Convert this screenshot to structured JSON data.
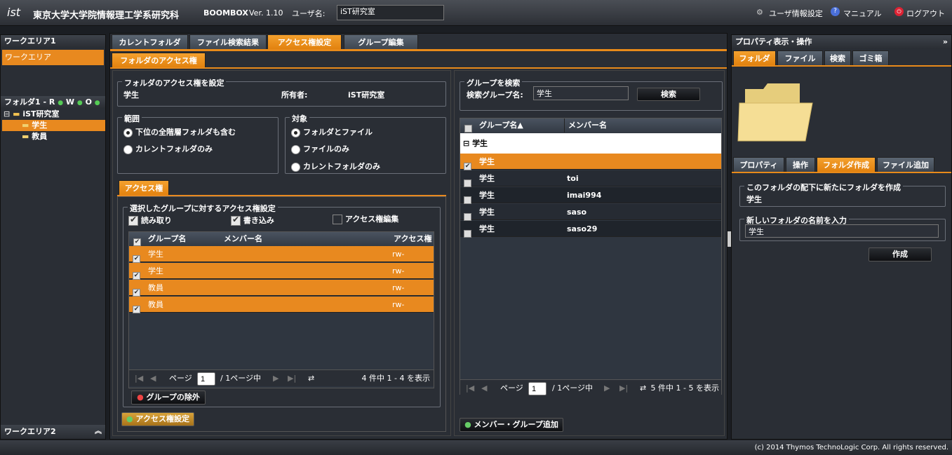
{
  "header": {
    "logo": "ist",
    "org": "東京大学大学院情報理工学系研究科",
    "product": "BOOMBOX",
    "version": "Ver. 1.10",
    "user_label": "ユーザ名:",
    "user_value": "iST研究室",
    "user_settings": "ユーザ情報設定",
    "manual": "マニュアル",
    "logout": "ログアウト"
  },
  "left": {
    "wa1_title": "ワークエリア1",
    "wa1_item": "ワークエリア",
    "folder1_title": "フォルダ1 - R",
    "perm_w": "W",
    "perm_o": "O",
    "tree_root": "iST研究室",
    "tree_items": [
      "学生",
      "教員"
    ],
    "wa2_title": "ワークエリア2"
  },
  "tabs": [
    "カレントフォルダ",
    "ファイル検索結果",
    "アクセス権設定",
    "グループ編集"
  ],
  "subtab": "フォルダのアクセス権",
  "access": {
    "legend": "フォルダのアクセス権を設定",
    "folder_name": "学生",
    "owner_label": "所有者:",
    "owner_value": "iST研究室",
    "scope_legend": "範囲",
    "scope_opts": [
      "下位の全階層フォルダも含む",
      "カレントフォルダのみ"
    ],
    "target_legend": "対象",
    "target_opts": [
      "フォルダとファイル",
      "ファイルのみ",
      "カレントフォルダのみ"
    ],
    "perm_tab": "アクセス権",
    "perm_legend": "選択したグループに対するアクセス権設定",
    "read": "読み取り",
    "write": "書き込み",
    "edit": "アクセス権編集",
    "cols": [
      "グループ名",
      "メンバー名",
      "アクセス権"
    ],
    "rows": [
      {
        "g": "学生",
        "m": "",
        "a": "rw-"
      },
      {
        "g": "学生",
        "m": "",
        "a": "rw-"
      },
      {
        "g": "教員",
        "m": "",
        "a": "rw-"
      },
      {
        "g": "教員",
        "m": "",
        "a": "rw-"
      }
    ],
    "page_label": "ページ",
    "page": "1",
    "page_of": "/ 1ページ中",
    "count": "4 件中 1 - 4 を表示",
    "remove_btn": "グループの除外",
    "apply_btn": "アクセス権設定"
  },
  "search": {
    "legend": "グループを検索",
    "label": "検索グループ名:",
    "value": "学生",
    "button": "検索",
    "cols": [
      "グループ名▲",
      "メンバー名"
    ],
    "group_header": "学生",
    "rows": [
      {
        "g": "学生",
        "m": ""
      },
      {
        "g": "学生",
        "m": "toi"
      },
      {
        "g": "学生",
        "m": "imai994"
      },
      {
        "g": "学生",
        "m": "saso"
      },
      {
        "g": "学生",
        "m": "saso29"
      }
    ],
    "page_label": "ページ",
    "page": "1",
    "page_of": "/ 1ページ中",
    "count": "5 件中 1 - 5 を表示",
    "add_btn": "メンバー・グループ追加"
  },
  "right": {
    "title": "プロパティ表示・操作",
    "tabs": [
      "フォルダ",
      "ファイル",
      "検索",
      "ゴミ箱"
    ],
    "subtabs": [
      "プロパティ",
      "操作",
      "フォルダ作成",
      "ファイル追加"
    ],
    "create_legend": "このフォルダの配下に新たにフォルダを作成",
    "create_parent": "学生",
    "name_legend": "新しいフォルダの名前を入力",
    "name_value": "学生",
    "create_btn": "作成"
  },
  "footer": "(c) 2014 Thymos TechnoLogic Corp. All rights reserved.",
  "colors": {
    "accent": "#e8891f",
    "bg": "#2a2e35"
  }
}
